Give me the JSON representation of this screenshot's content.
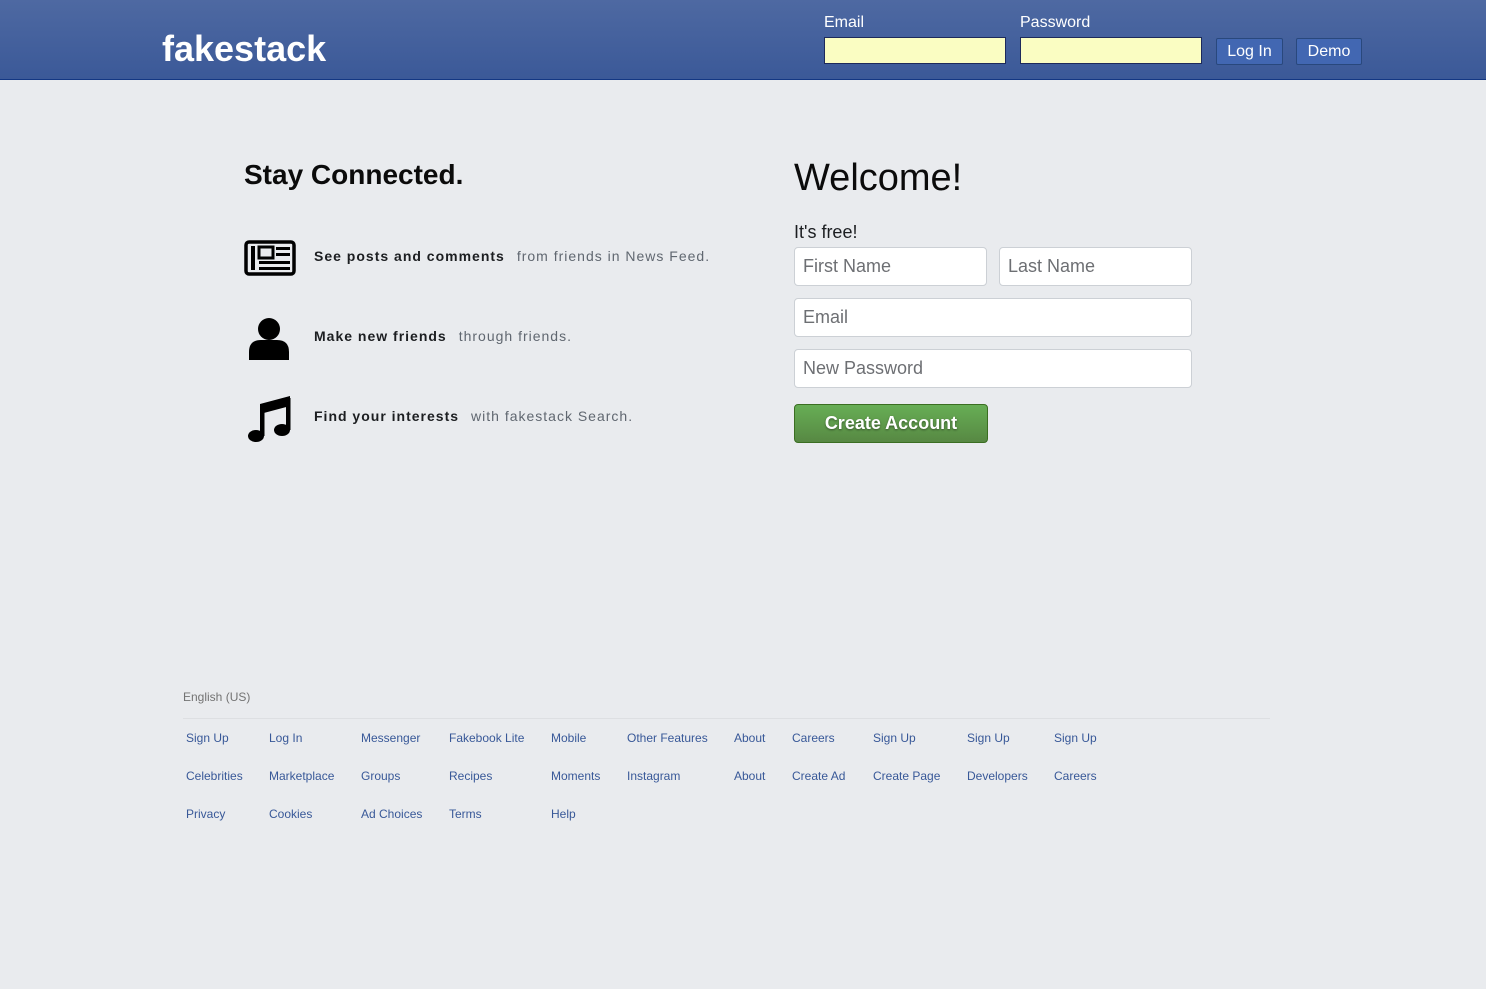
{
  "header": {
    "logo": "fakestack",
    "email_label": "Email",
    "password_label": "Password",
    "email_value": "",
    "password_value": "",
    "login_button": "Log In",
    "demo_button": "Demo",
    "bar_color": "#3b5998"
  },
  "left": {
    "tagline": "Stay Connected.",
    "features": [
      {
        "icon": "newspaper-icon",
        "strong": "See posts and comments",
        "muted": "from friends in News Feed."
      },
      {
        "icon": "user-icon",
        "strong": "Make new friends",
        "muted": "through friends."
      },
      {
        "icon": "music-note-icon",
        "strong": "Find your interests",
        "muted": "with fakestack Search."
      }
    ]
  },
  "signup": {
    "title": "Welcome!",
    "subtitle": "It's free!",
    "first_name_placeholder": "First Name",
    "last_name_placeholder": "Last Name",
    "email_placeholder": "Email",
    "password_placeholder": "New Password",
    "create_button": "Create Account",
    "button_color": "#5b9b44"
  },
  "footer": {
    "language": "English (US)",
    "rows": [
      [
        "Sign Up",
        "Log In",
        "Messenger",
        "Fakebook Lite",
        "Mobile",
        "Other Features",
        "About",
        "Careers",
        "Sign Up",
        "Sign Up",
        "Sign Up"
      ],
      [
        "Celebrities",
        "Marketplace",
        "Groups",
        "Recipes",
        "Moments",
        "Instagram",
        "About",
        "Create Ad",
        "Create Page",
        "Developers",
        "Careers"
      ],
      [
        "Privacy",
        "Cookies",
        "Ad Choices",
        "Terms",
        "Help"
      ]
    ]
  }
}
